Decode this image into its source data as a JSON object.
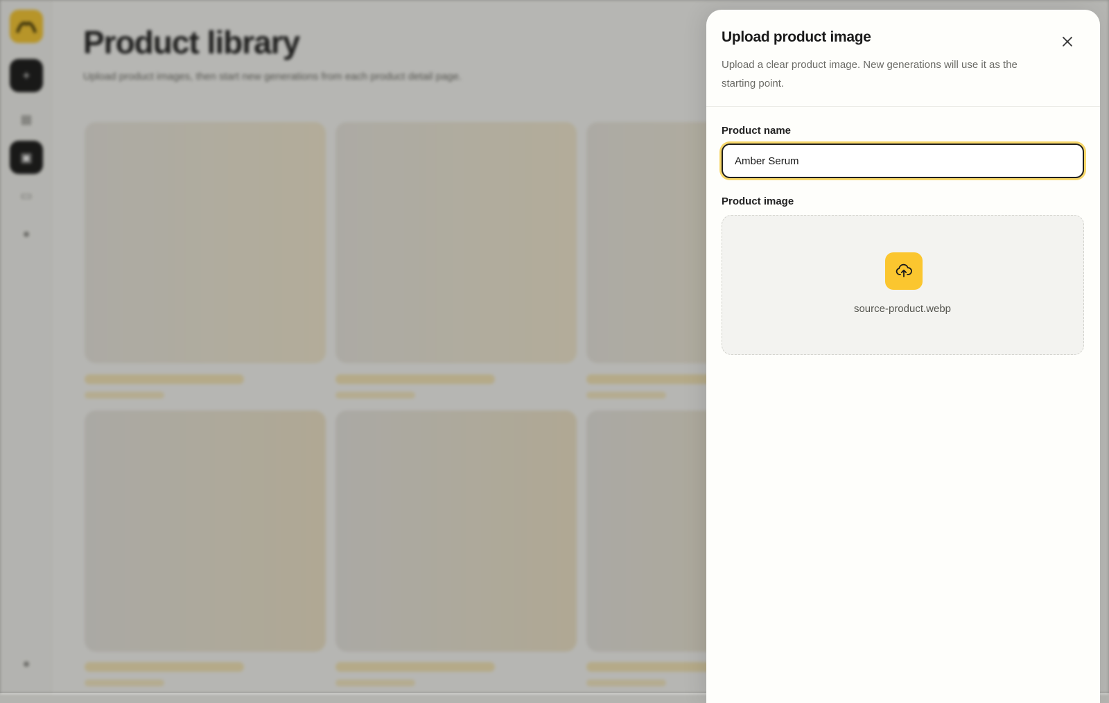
{
  "background": {
    "page_title": "Product library",
    "page_subtitle": "Upload product images, then start new generations from each product detail page."
  },
  "rail": {
    "icons": [
      "logo-icon",
      "plus-icon",
      "grid-icon",
      "library-icon",
      "billing-icon",
      "settings-icon",
      "avatar-icon"
    ]
  },
  "drawer": {
    "title": "Upload product image",
    "description": "Upload a clear product image. New generations will use it as the starting point.",
    "close_icon": "close-icon",
    "product_name": {
      "label": "Product name",
      "value": "Amber Serum"
    },
    "product_image": {
      "label": "Product image",
      "upload_icon": "cloud-upload-icon",
      "file_name": "source-product.webp"
    }
  },
  "colors": {
    "accent": "#fbc62f",
    "focus_ring": "#f7d76a",
    "text_primary": "#1a1a1a"
  }
}
